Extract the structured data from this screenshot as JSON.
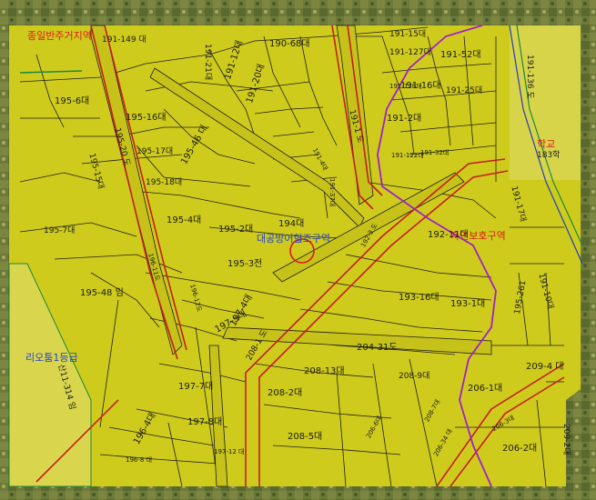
{
  "zones": {
    "general_residential": "종일반주거지역",
    "school": "학교",
    "school_code": "183학",
    "nature_protection": "자연보호구역",
    "agricultural": "리오툼1등급",
    "heritage": "대공방어협조구역"
  },
  "parcels": {
    "p191_149": "191-149 대",
    "p191_2_20": "191-2 대",
    "p191_21": "191-21대",
    "p191_12": "191-12대",
    "p191_20": "191-20대",
    "p190_68": "190-68대",
    "p191_15": "191-15대",
    "p191_127": "191-127대",
    "p191_52": "191-52대",
    "p191_16": "191-16대",
    "p191_125": "191-25대",
    "p191_2": "191-2대",
    "p195_6": "195-6대",
    "p195_16": "195-16대",
    "p195_17": "195-17대",
    "p195_18": "195-18대",
    "p195_46": "195-46 대",
    "p195_15": "195-15대",
    "p195_4": "195-4대",
    "p195_2": "195-2대",
    "p195_7": "195-7대",
    "p195_3": "195-3전",
    "p194": "194대",
    "p195_48": "195-48 임",
    "p196_1": "196-1대",
    "p192_11": "192-11대",
    "p193_16": "193-16대",
    "p193_1": "193-1대",
    "p195_2_61": "195-261",
    "p191_10": "191-10대",
    "p191_17": "191-17대",
    "p197_4": "197-4대",
    "p197_5": "197-5대",
    "p197_7": "197-7대",
    "p197_8": "197-8대",
    "p197_12": "197-12 대",
    "p196_4": "196-4대",
    "p196_8": "196-8 대",
    "p208_13": "208-13대",
    "p208_2": "208-2대",
    "p208_5": "208-5대",
    "p208_9": "208-9대",
    "p206_1": "206-1대",
    "p206_2": "206-2대",
    "p209_4": "209-4 대",
    "p209_2": "209-2대",
    "p204_31": "204-31도",
    "p191_128": "191-128대",
    "p191_122": "191-122대",
    "p191_32": "191-32대",
    "p191_1_road": "191-1 도",
    "p195_20_road": "195-20 도",
    "p208_1_road": "208-1 도",
    "p191_136": "191-136 도",
    "p191_4": "191-4대",
    "p191_37": "191-37대",
    "p191_182": "191-182 도",
    "p195_1_road": "195-1도",
    "p196_12": "196-12도",
    "p196_11": "196-11도",
    "p192_3": "192-3 도",
    "p206_3": "206-3대",
    "p206_34": "206-34 대",
    "p206_6": "206-6대",
    "p208_7": "208-7대",
    "p191_3": "191-3",
    "p311_314": "산11-314 임"
  },
  "colors": {
    "parcel_fill": "#cfcb1c",
    "road_fill": "#c9c51a",
    "parcel_line": "#1e1e1e",
    "zone_line_red": "#c41e1e",
    "zone_line_magenta": "#a020c8",
    "zone_line_green": "#1a8a3a",
    "zone_line_blue": "#1f3fb8",
    "background_texture": "#6f7a3c"
  }
}
